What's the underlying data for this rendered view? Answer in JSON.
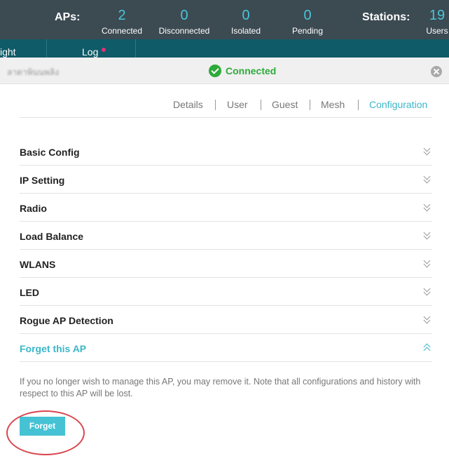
{
  "topbar": {
    "aps_label": "APs:",
    "aps": [
      {
        "value": "2",
        "label": "Connected"
      },
      {
        "value": "0",
        "label": "Disconnected"
      },
      {
        "value": "0",
        "label": "Isolated"
      },
      {
        "value": "0",
        "label": "Pending"
      }
    ],
    "stations_label": "Stations:",
    "stations": {
      "value": "19",
      "label": "Users"
    }
  },
  "nav": {
    "items": [
      {
        "label": "ight"
      },
      {
        "label": "Log"
      }
    ]
  },
  "panel": {
    "ap_name": "ลาดาพินนพลิง",
    "status": "Connected"
  },
  "tabs": [
    {
      "label": "Details"
    },
    {
      "label": "User"
    },
    {
      "label": "Guest"
    },
    {
      "label": "Mesh"
    },
    {
      "label": "Configuration",
      "active": true
    }
  ],
  "sections": [
    {
      "label": "Basic Config"
    },
    {
      "label": "IP Setting"
    },
    {
      "label": "Radio"
    },
    {
      "label": "Load Balance"
    },
    {
      "label": "WLANS"
    },
    {
      "label": "LED"
    },
    {
      "label": "Rogue AP Detection"
    },
    {
      "label": "Forget this AP",
      "open": true
    }
  ],
  "forget": {
    "note": "If you no longer wish to manage this AP, you may remove it. Note that all configurations and history with respect to this AP will be lost.",
    "button": "Forget"
  },
  "colors": {
    "accent": "#45c2d3",
    "header_bg": "#3c4a52",
    "nav_bg": "#0f5b67",
    "connected": "#2eaa3a",
    "annotation_ring": "#d9474f"
  }
}
